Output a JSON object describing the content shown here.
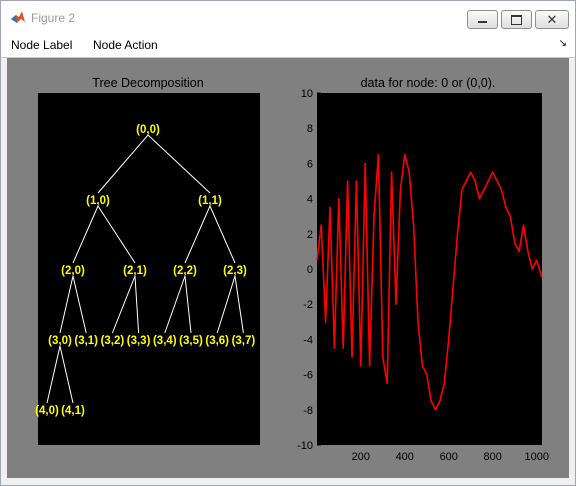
{
  "window": {
    "title": "Figure 2",
    "minimize_icon": "minimize-icon",
    "maximize_icon": "maximize-icon",
    "close_icon": "close-icon"
  },
  "menu": {
    "items": [
      "Node Label",
      "Node Action"
    ],
    "dock_icon": "dock-arrow-icon"
  },
  "colors": {
    "figure_bg": "#808080",
    "axes_bg": "#000000",
    "node_label": "#ffff00",
    "tree_edge": "#ffffff",
    "signal": "#ff0000"
  },
  "tree": {
    "title": "Tree Decomposition",
    "nodes": [
      {
        "label": "(0,0)",
        "d": 0,
        "p": 0
      },
      {
        "label": "(1,0)",
        "d": 1,
        "p": 0
      },
      {
        "label": "(1,1)",
        "d": 1,
        "p": 1
      },
      {
        "label": "(2,0)",
        "d": 2,
        "p": 0
      },
      {
        "label": "(2,1)",
        "d": 2,
        "p": 1
      },
      {
        "label": "(2,2)",
        "d": 2,
        "p": 2
      },
      {
        "label": "(2,3)",
        "d": 2,
        "p": 3
      },
      {
        "label": "(3,0)",
        "d": 3,
        "p": 0
      },
      {
        "label": "(3,1)",
        "d": 3,
        "p": 1
      },
      {
        "label": "(3,2)",
        "d": 3,
        "p": 2
      },
      {
        "label": "(3,3)",
        "d": 3,
        "p": 3
      },
      {
        "label": "(3,4)",
        "d": 3,
        "p": 4
      },
      {
        "label": "(3,5)",
        "d": 3,
        "p": 5
      },
      {
        "label": "(3,6)",
        "d": 3,
        "p": 6
      },
      {
        "label": "(3,7)",
        "d": 3,
        "p": 7
      },
      {
        "label": "(4,0)",
        "d": 4,
        "p": 0
      },
      {
        "label": "(4,1)",
        "d": 4,
        "p": 1
      }
    ]
  },
  "chart_data": {
    "type": "line",
    "title": "data for node: 0 or (0,0).",
    "xlabel": "",
    "ylabel": "",
    "xlim": [
      1,
      1024
    ],
    "ylim": [
      -10,
      10
    ],
    "x_ticks": [
      200,
      400,
      600,
      800,
      1000
    ],
    "y_ticks": [
      10,
      8,
      6,
      4,
      2,
      0,
      -2,
      -4,
      -6,
      -8,
      -10
    ],
    "grid": false,
    "series": [
      {
        "color": "#ff0000",
        "x": [
          1,
          20,
          40,
          60,
          80,
          100,
          120,
          140,
          160,
          180,
          200,
          220,
          240,
          260,
          280,
          300,
          320,
          340,
          360,
          380,
          400,
          420,
          440,
          460,
          480,
          500,
          520,
          540,
          560,
          580,
          600,
          620,
          640,
          660,
          680,
          700,
          720,
          740,
          760,
          780,
          800,
          820,
          840,
          860,
          880,
          900,
          920,
          940,
          960,
          980,
          1000,
          1024
        ],
        "y": [
          0.5,
          2.5,
          -3,
          3.5,
          -4.5,
          4,
          -4.5,
          5,
          -5,
          5,
          -5.5,
          6,
          -5.5,
          3,
          6.5,
          -5,
          -6.5,
          5.5,
          -2,
          4.5,
          6.5,
          5.5,
          2.5,
          -3,
          -5.5,
          -6,
          -7.5,
          -8,
          -7.5,
          -6.5,
          -4,
          -1,
          2,
          4.5,
          5,
          5.5,
          5,
          4,
          4.5,
          5,
          5.5,
          5,
          4.5,
          3.5,
          3,
          1.5,
          1,
          2.5,
          1,
          0,
          0.5,
          -0.5
        ]
      }
    ]
  }
}
